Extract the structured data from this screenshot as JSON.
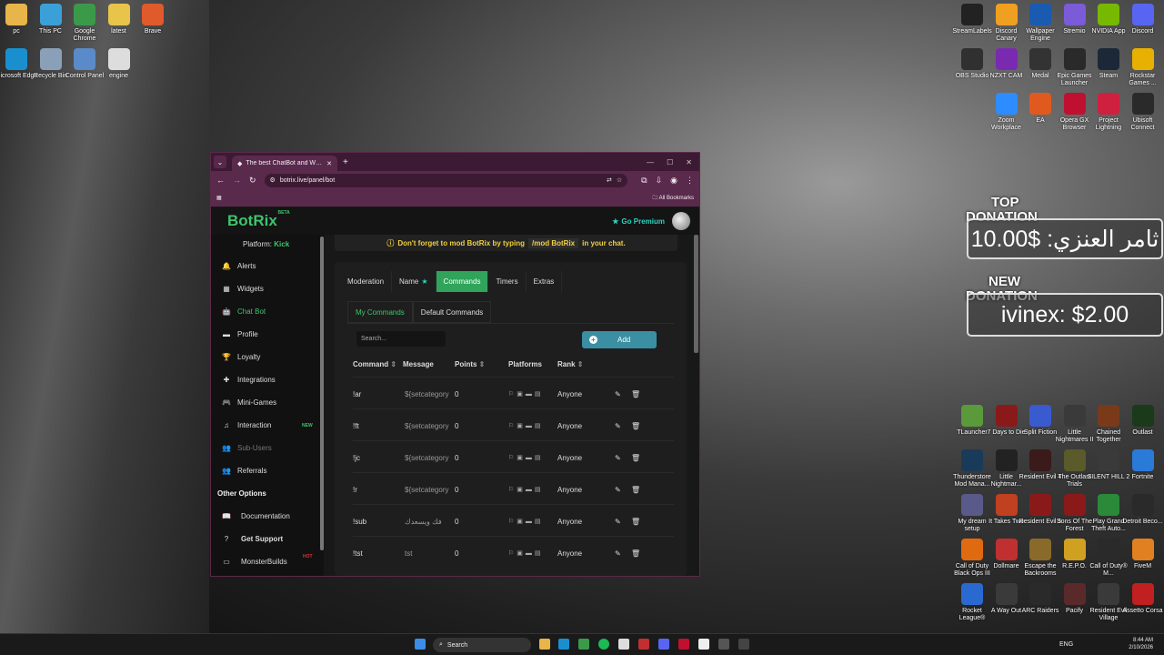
{
  "desktop_left_icons": [
    {
      "label": "pc",
      "icon": "folder-icon",
      "color": "#e8b54a"
    },
    {
      "label": "This PC",
      "icon": "monitor-icon",
      "color": "#3ba0d8"
    },
    {
      "label": "Google Chrome",
      "icon": "chrome-icon",
      "color": "#3a9a4a"
    },
    {
      "label": "latest",
      "icon": "folder-icon",
      "color": "#e8c44a"
    },
    {
      "label": "Brave",
      "icon": "brave-icon",
      "color": "#e05a2b"
    },
    {
      "label": "Microsoft Edge",
      "icon": "edge-icon",
      "color": "#1a8fd0"
    },
    {
      "label": "Recycle Bin",
      "icon": "recycle-bin-icon",
      "color": "#8aa0b8"
    },
    {
      "label": "Control Panel",
      "icon": "control-panel-icon",
      "color": "#5a8ac8"
    },
    {
      "label": "engine",
      "icon": "file-icon",
      "color": "#dddddd"
    }
  ],
  "desktop_right_top_icons": [
    {
      "label": "StreamLabels",
      "color": "#222222"
    },
    {
      "label": "Discord Canary",
      "color": "#f0a020"
    },
    {
      "label": "Wallpaper Engine",
      "color": "#1a5ab0"
    },
    {
      "label": "Stremio",
      "color": "#7b5bd8"
    },
    {
      "label": "NVIDIA App",
      "color": "#76b900"
    },
    {
      "label": "Discord",
      "color": "#5865f2"
    },
    {
      "label": "OBS Studio",
      "color": "#303030"
    },
    {
      "label": "NZXT CAM",
      "color": "#7a2ab0"
    },
    {
      "label": "Medal",
      "color": "#333333"
    },
    {
      "label": "Epic Games Launcher",
      "color": "#2a2a2a"
    },
    {
      "label": "Steam",
      "color": "#1b2838"
    },
    {
      "label": "Rockstar Games ...",
      "color": "#e8b000"
    },
    {
      "label": "Zoom Workplace",
      "color": "#2d8cff"
    },
    {
      "label": "EA",
      "color": "#e05a20"
    },
    {
      "label": "Opera GX Browser",
      "color": "#c01030"
    },
    {
      "label": "Project Lightning",
      "color": "#d02040"
    },
    {
      "label": "Ubisoft Connect",
      "color": "#2a2a2a"
    }
  ],
  "desktop_right_bottom_icons": [
    {
      "label": "TLauncher",
      "color": "#5a9a3a"
    },
    {
      "label": "7 Days to Die",
      "color": "#8a1a1a"
    },
    {
      "label": "Split Fiction",
      "color": "#3a5ad0"
    },
    {
      "label": "Little Nightmares II",
      "color": "#3a3a3a"
    },
    {
      "label": "Chained Together",
      "color": "#7a3a1a"
    },
    {
      "label": "Outlast",
      "color": "#1a3a1a"
    },
    {
      "label": "Thunderstore Mod Mana...",
      "color": "#1a3a5a"
    },
    {
      "label": "Little Nightmar...",
      "color": "#222222"
    },
    {
      "label": "Resident Evil 4",
      "color": "#3a1a1a"
    },
    {
      "label": "The Outlast Trials",
      "color": "#5a5a2a"
    },
    {
      "label": "SILENT HILL 2",
      "color": "#3a3a3a"
    },
    {
      "label": "Fortnite",
      "color": "#2a7ad8"
    },
    {
      "label": "My dream setup",
      "color": "#5a5a8a"
    },
    {
      "label": "It Takes Two",
      "color": "#c04020"
    },
    {
      "label": "Resident Evil 5",
      "color": "#8a1a1a"
    },
    {
      "label": "Sons Of The Forest",
      "color": "#8a1a1a"
    },
    {
      "label": "Play Grand Theft Auto...",
      "color": "#2a8a3a"
    },
    {
      "label": "Detroit Beco...",
      "color": "#2a2a2a"
    },
    {
      "label": "Call of Duty Black Ops III",
      "color": "#e06a10"
    },
    {
      "label": "Dollmare",
      "color": "#c03030"
    },
    {
      "label": "Escape the Backrooms",
      "color": "#8a6a2a"
    },
    {
      "label": "R.E.P.O.",
      "color": "#d0a020"
    },
    {
      "label": "Call of Duty® M...",
      "color": "#2a2a2a"
    },
    {
      "label": "FiveM",
      "color": "#e08020"
    },
    {
      "label": "Rocket League®",
      "color": "#2a6ad0"
    },
    {
      "label": "A Way Out",
      "color": "#3a3a3a"
    },
    {
      "label": "ARC Raiders",
      "color": "#2a2a2a"
    },
    {
      "label": "Pacify",
      "color": "#5a2a2a"
    },
    {
      "label": "Resident Evil Village",
      "color": "#3a3a3a"
    },
    {
      "label": "Assetto Corsa",
      "color": "#c02020"
    }
  ],
  "donations": {
    "top_label_1": "TOP",
    "top_label_2": "DONATION",
    "top_value": "ثامر العنزي: $10.00",
    "new_label_1": "NEW",
    "new_label_2": "DONATION",
    "new_value": "ivinex: $2.00"
  },
  "browser": {
    "tab_title": "The best ChatBot and Widgets",
    "url": "botrix.live/panel/bot",
    "bookmarks_label": "All Bookmarks"
  },
  "app": {
    "logo": "BotRix",
    "logo_badge": "BETA",
    "go_premium": "Go Premium",
    "platform_label": "Platform:",
    "platform_value": "Kick",
    "banner_text_1": "Don't forget to mod BotRix by typing",
    "banner_cmd": "/mod BotRix",
    "banner_text_2": "in your chat.",
    "sidebar": [
      {
        "label": "Alerts",
        "icon": "bell-icon",
        "state": ""
      },
      {
        "label": "Widgets",
        "icon": "widgets-icon",
        "state": ""
      },
      {
        "label": "Chat Bot",
        "icon": "robot-icon",
        "state": "active"
      },
      {
        "label": "Profile",
        "icon": "id-card-icon",
        "state": ""
      },
      {
        "label": "Loyalty",
        "icon": "trophy-icon",
        "state": ""
      },
      {
        "label": "Integrations",
        "icon": "puzzle-icon",
        "state": ""
      },
      {
        "label": "Mini-Games",
        "icon": "gamepad-icon",
        "state": ""
      },
      {
        "label": "Interaction",
        "icon": "music-icon",
        "state": "new"
      },
      {
        "label": "Sub-Users",
        "icon": "user-group-icon",
        "state": "dim"
      },
      {
        "label": "Referrals",
        "icon": "users-icon",
        "state": ""
      }
    ],
    "new_badge": "NEW",
    "other_options_title": "Other Options",
    "other_options": [
      {
        "label": "Documentation",
        "icon": "book-icon"
      },
      {
        "label": "Get Support",
        "icon": "question-icon"
      },
      {
        "label": "MonsterBuilds",
        "icon": "monitor-icon"
      }
    ],
    "hot_badge": "HOT",
    "tabs": [
      "Moderation",
      "Name",
      "Commands",
      "Timers",
      "Extras"
    ],
    "active_tab": "Commands",
    "subtabs": [
      "My Commands",
      "Default Commands"
    ],
    "active_subtab": "My Commands",
    "search_placeholder": "Search...",
    "add_label": "Add",
    "columns": [
      "Command",
      "Message",
      "Points",
      "Platforms",
      "Rank"
    ],
    "rows": [
      {
        "command": "!ar",
        "message": "${setcategory",
        "points": "0",
        "rank": "Anyone"
      },
      {
        "command": "!ft",
        "message": "${setcategory",
        "points": "0",
        "rank": "Anyone"
      },
      {
        "command": "!jc",
        "message": "${setcategory",
        "points": "0",
        "rank": "Anyone"
      },
      {
        "command": "!r",
        "message": "${setcategory",
        "points": "0",
        "rank": "Anyone"
      },
      {
        "command": "!sub",
        "message": "فك ويسعدك",
        "points": "0",
        "rank": "Anyone"
      },
      {
        "command": "!tst",
        "message": "tst",
        "points": "0",
        "rank": "Anyone"
      }
    ]
  },
  "taskbar": {
    "search_label": "Search",
    "language": "ENG",
    "time": "8:44 AM",
    "date": "2/10/2026"
  }
}
